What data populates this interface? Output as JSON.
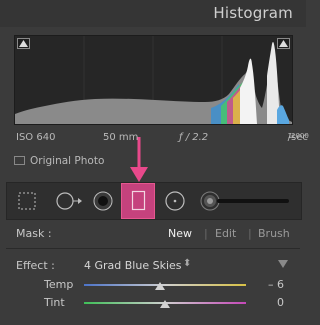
{
  "panel": {
    "title": "Histogram"
  },
  "histogram": {
    "iso": "ISO 640",
    "focal_length": "50 mm",
    "aperture": "ƒ / 2.2",
    "shutter_numerator": "1",
    "shutter_denominator": "2000",
    "shutter_unit": "sec",
    "original_photo_label": "Original Photo"
  },
  "tools": [
    {
      "name": "crop-overlay-tool"
    },
    {
      "name": "spot-removal-tool"
    },
    {
      "name": "red-eye-tool"
    },
    {
      "name": "graduated-filter-tool",
      "active": true
    },
    {
      "name": "radial-filter-tool"
    },
    {
      "name": "adjustment-brush-tool"
    }
  ],
  "mask": {
    "label": "Mask :",
    "new": "New",
    "edit": "Edit",
    "brush": "Brush",
    "separator": "|"
  },
  "effect": {
    "label": "Effect :",
    "value": "4 Grad Blue Skies",
    "stepper": "⬍"
  },
  "sliders": [
    {
      "label": "Temp",
      "value_text": "– 6",
      "value": -6
    },
    {
      "label": "Tint",
      "value_text": "0",
      "value": 0
    }
  ],
  "colors": {
    "accent": "#c5427d",
    "arrow": "#e8498b"
  }
}
